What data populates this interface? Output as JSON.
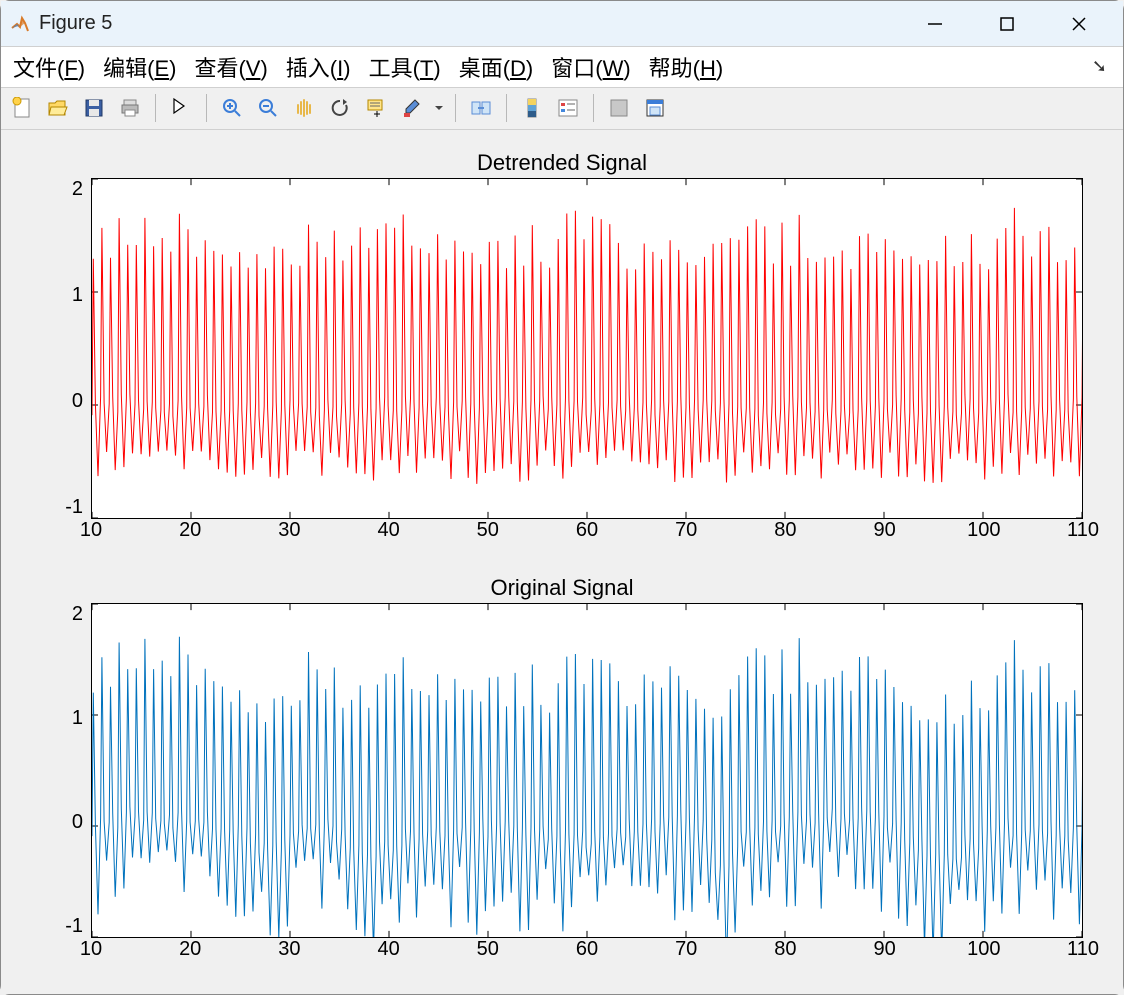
{
  "window": {
    "title": "Figure 5"
  },
  "menu": {
    "file": "文件(F)",
    "edit": "编辑(E)",
    "view": "查看(V)",
    "insert": "插入(I)",
    "tools": "工具(T)",
    "desktop": "桌面(D)",
    "window": "窗口(W)",
    "help": "帮助(H)"
  },
  "chart_data": [
    {
      "type": "line",
      "title": "Detrended Signal",
      "xlabel": "",
      "ylabel": "",
      "xlim": [
        10,
        110
      ],
      "ylim": [
        -1,
        2
      ],
      "xticks": [
        10,
        20,
        30,
        40,
        50,
        60,
        70,
        80,
        90,
        100,
        110
      ],
      "yticks": [
        -1,
        0,
        1,
        2
      ],
      "color": "#ff0000",
      "description": "Dense oscillatory signal with peaks ranging roughly 1.3–1.8 and troughs around -0.5 to -0.7, baseline near 0. Approximately 110–120 cycles across the x range (roughly 1.1 cycles per x-unit).",
      "approx_envelope": {
        "upper_peak_range": [
          1.2,
          1.8
        ],
        "lower_trough_range": [
          -0.7,
          -0.4
        ],
        "baseline": 0.0
      }
    },
    {
      "type": "line",
      "title": "Original Signal",
      "xlabel": "",
      "ylabel": "",
      "xlim": [
        10,
        110
      ],
      "ylim": [
        -1,
        2
      ],
      "xticks": [
        10,
        20,
        30,
        40,
        50,
        60,
        70,
        80,
        90,
        100,
        110
      ],
      "yticks": [
        -1,
        0,
        1,
        2
      ],
      "color": "#0072bd",
      "description": "Dense oscillatory signal similar to the top plot but with visible low-frequency drift/trend; peaks 1.2–1.7, troughs around -0.5 to -0.9 (a deep dip near x≈73 reaching ~-1.0).",
      "approx_envelope": {
        "upper_peak_range": [
          1.1,
          1.75
        ],
        "lower_trough_range": [
          -0.95,
          -0.3
        ],
        "baseline": 0.0
      },
      "notable_features": [
        {
          "x": 73,
          "y": -1.0,
          "note": "deep trough"
        },
        {
          "x": 28,
          "y_low": -0.6,
          "note": "local baseline dip"
        },
        {
          "x": 37,
          "y_low": -0.6,
          "note": "local baseline dip"
        }
      ]
    }
  ]
}
